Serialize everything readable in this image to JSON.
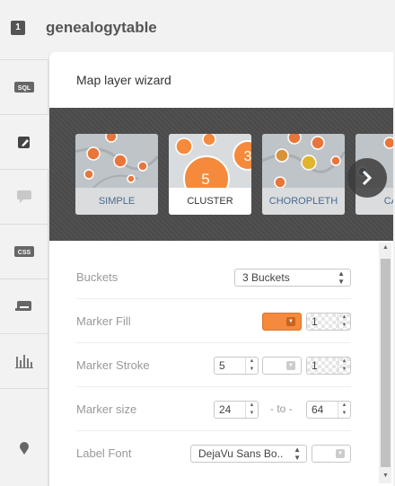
{
  "header": {
    "layer_number": "1",
    "layer_name": "genealogytable"
  },
  "tools": [
    {
      "name": "sql",
      "label": "SQL"
    },
    {
      "name": "wizard",
      "label": ""
    },
    {
      "name": "infowindow",
      "label": ""
    },
    {
      "name": "css",
      "label": "CSS"
    },
    {
      "name": "legends",
      "label": ""
    },
    {
      "name": "filters",
      "label": ""
    },
    {
      "name": "mapping",
      "label": ""
    }
  ],
  "panel": {
    "title": "Map layer wizard"
  },
  "wizards": [
    {
      "label": "SIMPLE",
      "selected": false
    },
    {
      "label": "CLUSTER",
      "selected": true,
      "cluster_values": [
        "5",
        "3"
      ]
    },
    {
      "label": "CHOROPLETH",
      "selected": false
    },
    {
      "label": "CATE",
      "selected": false
    }
  ],
  "form": {
    "buckets": {
      "label": "Buckets",
      "value": "3 Buckets"
    },
    "marker_fill": {
      "label": "Marker Fill",
      "color": "#f58a3c",
      "opacity": "1"
    },
    "marker_stroke": {
      "label": "Marker Stroke",
      "width": "5",
      "opacity": "1"
    },
    "marker_size": {
      "label": "Marker size",
      "min": "24",
      "to_label": "- to -",
      "max": "64"
    },
    "label_font": {
      "label": "Label Font",
      "value": "DejaVu Sans Bo.."
    }
  },
  "colors": {
    "accent_orange": "#f58a3c",
    "dark_strip": "#4a4a4a",
    "link_blue": "#4a6a8e"
  }
}
